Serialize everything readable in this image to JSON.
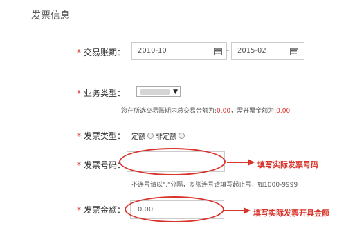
{
  "section_title": "发票信息",
  "required_mark": "*",
  "period": {
    "label": "交易账期：",
    "start": "2010-10",
    "end": "2015-02",
    "separator": "-",
    "icon": "calendar-icon"
  },
  "business_type": {
    "label": "业务类型：",
    "selected": "",
    "arrow": "▼",
    "hint_prefix": "您在所选交易账期内总交易金额为:",
    "total_amount": "0.00",
    "hint_middle": "，需开票金额为:",
    "invoice_amount": "0.00"
  },
  "invoice_type": {
    "label": "发票类型：",
    "options": [
      "定额",
      "非定额"
    ]
  },
  "invoice_number": {
    "label": "发票号码：",
    "value": "",
    "hint": "不连号请以\",\"分隔，多张连号请填写起止号，如1000-9999",
    "annotation": "填写实际发票号码"
  },
  "invoice_amount": {
    "label": "发票金额：",
    "value": "0.00",
    "annotation": "填写实际发票开具金额"
  },
  "colors": {
    "accent_red": "#d9342b",
    "border_gray": "#cccccc"
  }
}
